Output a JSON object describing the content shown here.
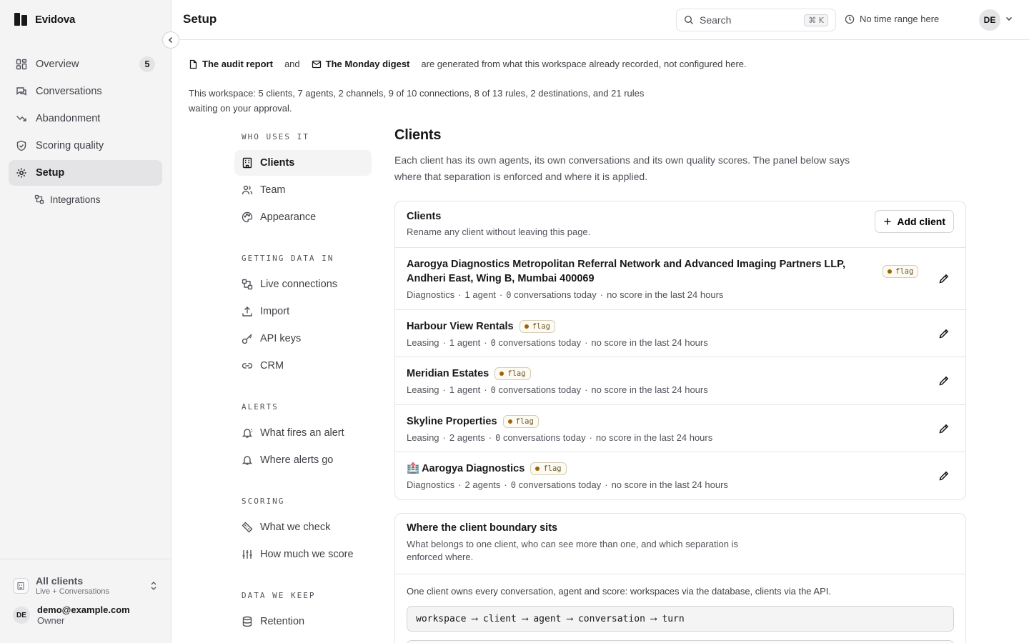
{
  "brand": {
    "name": "Evidova"
  },
  "sidebar": {
    "items": [
      {
        "label": "Overview",
        "icon": "grid-icon",
        "badge": "5"
      },
      {
        "label": "Conversations",
        "icon": "chat-icon"
      },
      {
        "label": "Abandonment",
        "icon": "trend-down-icon"
      },
      {
        "label": "Scoring quality",
        "icon": "shield-icon"
      },
      {
        "label": "Setup",
        "icon": "gear-icon",
        "active": true
      }
    ],
    "sub_items": [
      {
        "label": "Integrations",
        "icon": "integrations-icon"
      }
    ],
    "client_switcher": {
      "title": "All clients",
      "subtitle": "Live + Conversations"
    },
    "user": {
      "initials": "DE",
      "email": "demo@example.com",
      "role": "Owner"
    }
  },
  "topbar": {
    "title": "Setup",
    "search_placeholder": "Search",
    "search_shortcut": "⌘ K",
    "time_range": "No time range here",
    "avatar_initials": "DE"
  },
  "notice": {
    "doc1": "The audit report",
    "and": "and",
    "doc2": "The Monday digest",
    "rest": "are generated from what this workspace already recorded, not configured here."
  },
  "summary": "This workspace: 5 clients, 7 agents, 2 channels, 9 of 10 connections, 8 of 13 rules, 2 destinations, and 21 rules waiting on your approval.",
  "subnav": {
    "sections": [
      {
        "title": "WHO USES IT",
        "items": [
          {
            "label": "Clients",
            "icon": "building-icon",
            "active": true
          },
          {
            "label": "Team",
            "icon": "users-icon"
          },
          {
            "label": "Appearance",
            "icon": "palette-icon"
          }
        ]
      },
      {
        "title": "GETTING DATA IN",
        "items": [
          {
            "label": "Live connections",
            "icon": "connections-icon"
          },
          {
            "label": "Import",
            "icon": "upload-icon"
          },
          {
            "label": "API keys",
            "icon": "key-icon"
          },
          {
            "label": "CRM",
            "icon": "link-icon"
          }
        ]
      },
      {
        "title": "ALERTS",
        "items": [
          {
            "label": "What fires an alert",
            "icon": "bell-ring-icon"
          },
          {
            "label": "Where alerts go",
            "icon": "bell-icon"
          }
        ]
      },
      {
        "title": "SCORING",
        "items": [
          {
            "label": "What we check",
            "icon": "ruler-icon"
          },
          {
            "label": "How much we score",
            "icon": "sliders-icon"
          }
        ]
      },
      {
        "title": "DATA WE KEEP",
        "items": [
          {
            "label": "Retention",
            "icon": "database-icon"
          }
        ]
      }
    ]
  },
  "main": {
    "title": "Clients",
    "description": "Each client has its own agents, its own conversations and its own quality scores. The panel below says where that separation is enforced and where it is applied.",
    "clients_card": {
      "title": "Clients",
      "subtitle": "Rename any client without leaving this page.",
      "add_label": "Add client",
      "flag_label": "flag",
      "rows": [
        {
          "name": "Aarogya Diagnostics Metropolitan Referral Network and Advanced Imaging Partners LLP, Andheri East, Wing B, Mumbai 400069",
          "category": "Diagnostics",
          "agents": "1 agent",
          "conv_num": "0",
          "conv_text": " conversations today",
          "score": "no score in the last 24 hours"
        },
        {
          "name": "Harbour View Rentals",
          "category": "Leasing",
          "agents": "1 agent",
          "conv_num": "0",
          "conv_text": " conversations today",
          "score": "no score in the last 24 hours"
        },
        {
          "name": "Meridian Estates",
          "category": "Leasing",
          "agents": "1 agent",
          "conv_num": "0",
          "conv_text": " conversations today",
          "score": "no score in the last 24 hours"
        },
        {
          "name": "Skyline Properties",
          "category": "Leasing",
          "agents": "2 agents",
          "conv_num": "0",
          "conv_text": " conversations today",
          "score": "no score in the last 24 hours"
        },
        {
          "name": "Aarogya Diagnostics",
          "category": "Diagnostics",
          "agents": "2 agents",
          "conv_num": "0",
          "conv_text": " conversations today",
          "score": "no score in the last 24 hours",
          "emoji": "🏥"
        }
      ]
    },
    "boundary_card": {
      "title": "Where the client boundary sits",
      "subtitle": "What belongs to one client, who can see more than one, and which separation is enforced where.",
      "line": "One client owns every conversation, agent and score: workspaces via the database, clients via the API.",
      "code": "workspace ⟶ client ⟶ agent ⟶ conversation ⟶ turn"
    }
  }
}
